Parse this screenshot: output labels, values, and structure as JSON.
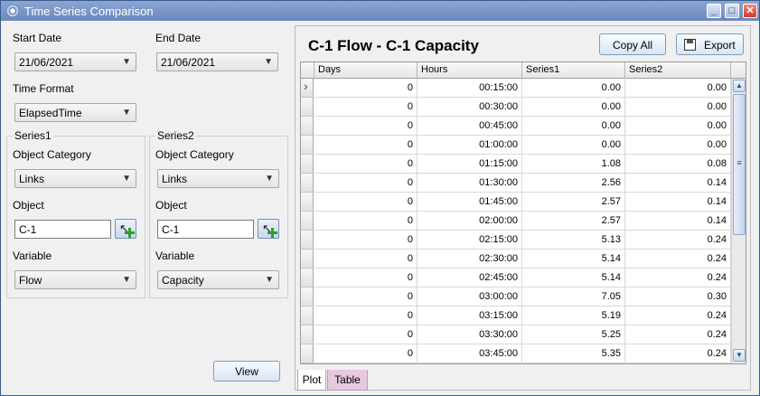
{
  "window": {
    "title": "Time Series Comparison",
    "controls": [
      "_",
      "□",
      "✕"
    ]
  },
  "left_panel": {
    "start_date": {
      "label": "Start Date",
      "value": "21/06/2021"
    },
    "end_date": {
      "label": "End Date",
      "value": "21/06/2021"
    },
    "time_format": {
      "label": "Time Format",
      "value": "ElapsedTime"
    },
    "series1": {
      "legend": "Series1",
      "category_label": "Object Category",
      "category_value": "Links",
      "object_label": "Object",
      "object_value": "C-1",
      "variable_label": "Variable",
      "variable_value": "Flow"
    },
    "series2": {
      "legend": "Series2",
      "category_label": "Object Category",
      "category_value": "Links",
      "object_label": "Object",
      "object_value": "C-1",
      "variable_label": "Variable",
      "variable_value": "Capacity"
    },
    "view_button": "View"
  },
  "right_panel": {
    "title": "C-1 Flow - C-1 Capacity",
    "copy_all": "Copy All",
    "export": "Export",
    "columns": [
      "Days",
      "Hours",
      "Series1",
      "Series2"
    ],
    "rows": [
      [
        "0",
        "00:15:00",
        "0.00",
        "0.00"
      ],
      [
        "0",
        "00:30:00",
        "0.00",
        "0.00"
      ],
      [
        "0",
        "00:45:00",
        "0.00",
        "0.00"
      ],
      [
        "0",
        "01:00:00",
        "0.00",
        "0.00"
      ],
      [
        "0",
        "01:15:00",
        "1.08",
        "0.08"
      ],
      [
        "0",
        "01:30:00",
        "2.56",
        "0.14"
      ],
      [
        "0",
        "01:45:00",
        "2.57",
        "0.14"
      ],
      [
        "0",
        "02:00:00",
        "2.57",
        "0.14"
      ],
      [
        "0",
        "02:15:00",
        "5.13",
        "0.24"
      ],
      [
        "0",
        "02:30:00",
        "5.14",
        "0.24"
      ],
      [
        "0",
        "02:45:00",
        "5.14",
        "0.24"
      ],
      [
        "0",
        "03:00:00",
        "7.05",
        "0.30"
      ],
      [
        "0",
        "03:15:00",
        "5.19",
        "0.24"
      ],
      [
        "0",
        "03:30:00",
        "5.25",
        "0.24"
      ],
      [
        "0",
        "03:45:00",
        "5.35",
        "0.24"
      ]
    ],
    "tabs": [
      "Plot",
      "Table"
    ]
  }
}
